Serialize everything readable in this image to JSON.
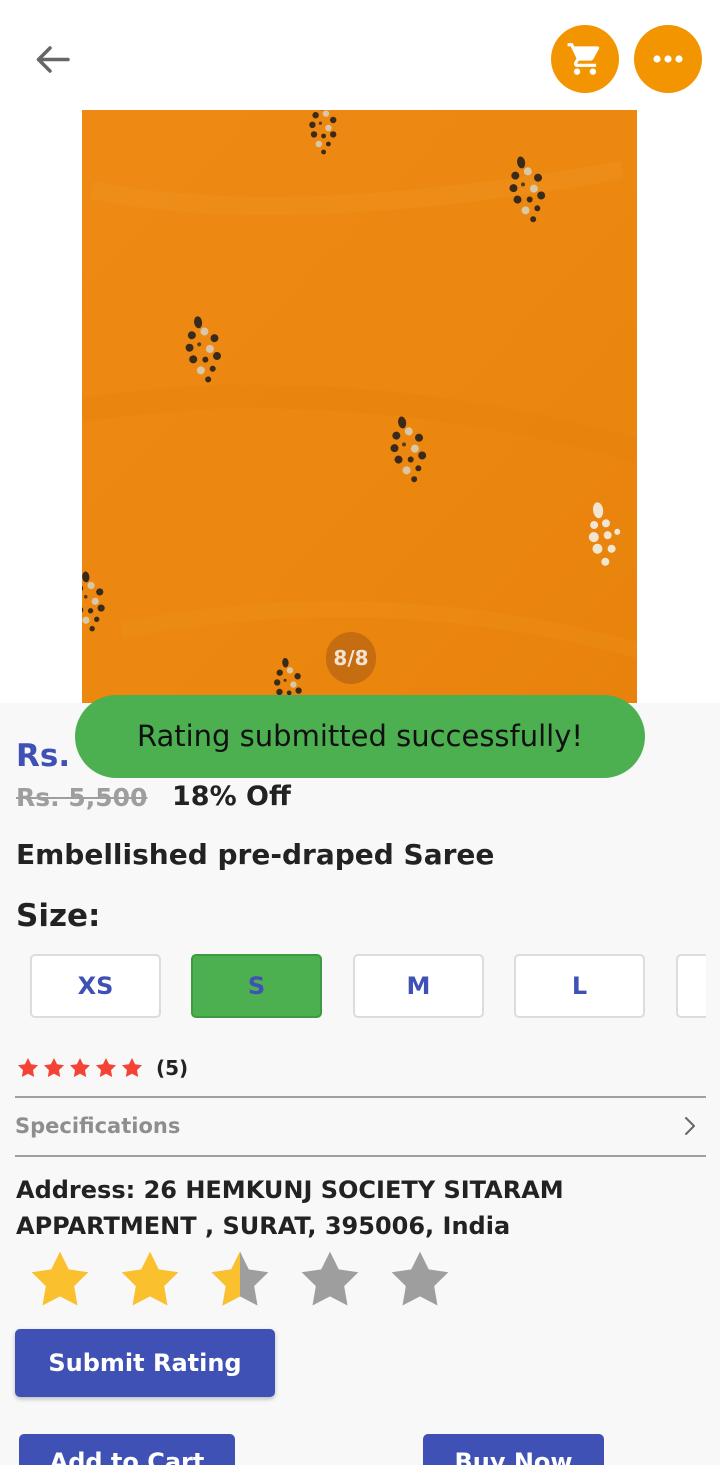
{
  "header": {
    "back_icon": "arrow-left-icon",
    "cart_icon": "shopping-cart-icon",
    "more_icon": "more-horizontal-icon",
    "accent_color": "#f29500"
  },
  "gallery": {
    "image_counter": "8/8",
    "image_color": "#ed8a12"
  },
  "pricing": {
    "current_prefix": "Rs.",
    "original_price": "Rs. 5,500",
    "discount": "18% Off"
  },
  "toast": {
    "message": "Rating submitted successfully!",
    "color": "#4caf50"
  },
  "product": {
    "name": "Embellished pre-draped Saree"
  },
  "sizes": {
    "label": "Size:",
    "options": [
      "XS",
      "S",
      "M",
      "L",
      ""
    ],
    "selected": "S"
  },
  "rating": {
    "stars": 5,
    "count": "(5)",
    "star_color": "#f44336"
  },
  "specifications": {
    "label": "Specifications"
  },
  "address": {
    "text": "Address: 26 HEMKUNJ SOCIETY SITARAM APPARTMENT , SURAT, 395006, India"
  },
  "rating_input": {
    "value": 2.5,
    "max": 5,
    "filled_color": "#fbc02d",
    "empty_color": "#9e9e9e"
  },
  "actions": {
    "submit_rating": "Submit Rating",
    "add_to_cart": "Add to Cart",
    "buy_now": "Buy Now",
    "primary_color": "#3f51b5"
  }
}
